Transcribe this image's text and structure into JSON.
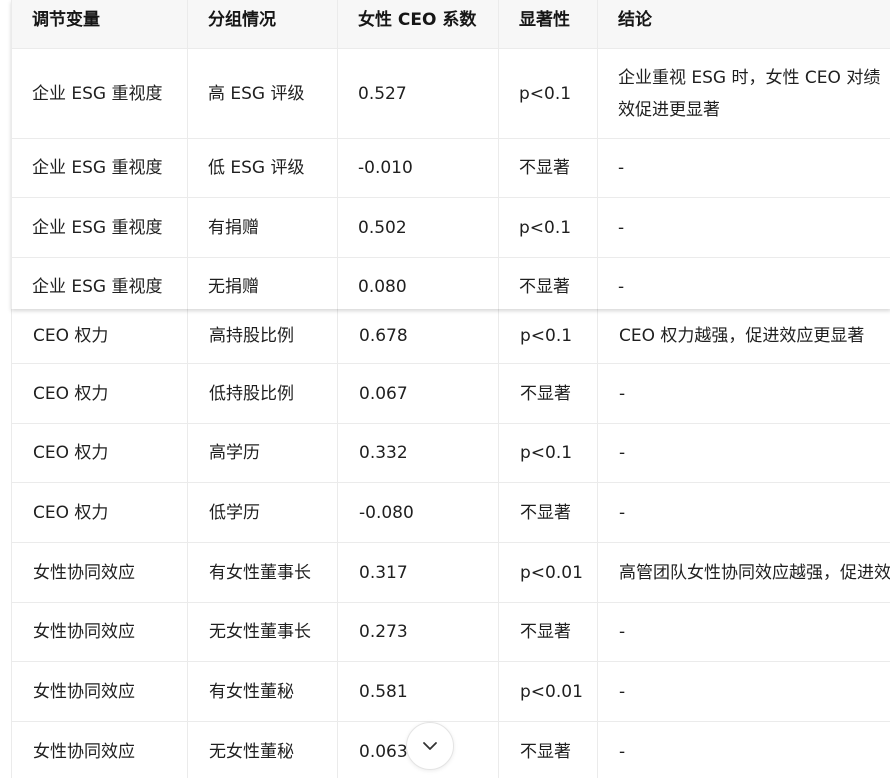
{
  "table": {
    "headers": [
      "调节变量",
      "分组情况",
      "女性 CEO 系数",
      "显著性",
      "结论"
    ],
    "rows_top": [
      {
        "var": "企业 ESG 重视度",
        "group": "高 ESG 评级",
        "coef": "0.527",
        "sig": "p<0.1",
        "conclusion": "企业重视 ESG 时，女性 CEO 对绩效促进更显著"
      },
      {
        "var": "企业 ESG 重视度",
        "group": "低 ESG 评级",
        "coef": "-0.010",
        "sig": "不显著",
        "conclusion": "-"
      },
      {
        "var": "企业 ESG 重视度",
        "group": "有捐赠",
        "coef": "0.502",
        "sig": "p<0.1",
        "conclusion": "-"
      },
      {
        "var": "企业 ESG 重视度",
        "group": "无捐赠",
        "coef": "0.080",
        "sig": "不显著",
        "conclusion": "-"
      }
    ],
    "rows_bottom": [
      {
        "var": "CEO 权力",
        "group": "高持股比例",
        "coef": "0.678",
        "sig": "p<0.1",
        "conclusion": "CEO 权力越强，促进效应更显著"
      },
      {
        "var": "CEO 权力",
        "group": "低持股比例",
        "coef": "0.067",
        "sig": "不显著",
        "conclusion": "-"
      },
      {
        "var": "CEO 权力",
        "group": "高学历",
        "coef": "0.332",
        "sig": "p<0.1",
        "conclusion": "-"
      },
      {
        "var": "CEO 权力",
        "group": "低学历",
        "coef": "-0.080",
        "sig": "不显著",
        "conclusion": "-"
      },
      {
        "var": "女性协同效应",
        "group": "有女性董事长",
        "coef": "0.317",
        "sig": "p<0.01",
        "conclusion": "高管团队女性协同效应越强，促进效应越显著"
      },
      {
        "var": "女性协同效应",
        "group": "无女性董事长",
        "coef": "0.273",
        "sig": "不显著",
        "conclusion": "-"
      },
      {
        "var": "女性协同效应",
        "group": "有女性董秘",
        "coef": "0.581",
        "sig": "p<0.01",
        "conclusion": "-"
      },
      {
        "var": "女性协同效应",
        "group": "无女性董秘",
        "coef": "0.063",
        "sig": "不显著",
        "conclusion": "-"
      }
    ]
  },
  "icons": {
    "scroll_down": "chevron-down-icon"
  },
  "colors": {
    "border": "#ebebeb",
    "header_bg": "#f7f7f7",
    "text": "#1f1f1f"
  }
}
